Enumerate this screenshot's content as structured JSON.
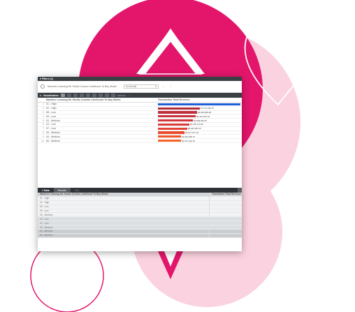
{
  "filters": {
    "title": "Filters (1)",
    "field_label": "Machine Learning ML Studio Custom Likelihood To Buy Model",
    "operator": "is not null",
    "add_symbol": "+",
    "remove_symbol": "×"
  },
  "visualization": {
    "title": "Visualization",
    "toolbar_text": "Options",
    "col_category": "Machine Learning ML Studio Custom Likelihood To Buy Model",
    "col_measure": "Transaction Total Revenue"
  },
  "chart_data": {
    "type": "bar",
    "categories": [
      "01 - High",
      "02 - High",
      "08 - Low",
      "09 - Low",
      "03 - Medium",
      "10 - Low",
      "07 - Low",
      "05 - Medium",
      "04 - Medium",
      "06 - Medium"
    ],
    "values": [
      14000000,
      7079060.57,
      6690899.28,
      6410209.44,
      5898699.87,
      5350113.92,
      5016081.97,
      4517147.22,
      3952868.27,
      3972219.3
    ],
    "labels": [
      "",
      "$7,079,060.57",
      "$6,690,899.28",
      "$6,410,209.44",
      "$5,898,699.87",
      "$5,350,113.92",
      "$5,016,081.97",
      "$4,517,147.22",
      "$3,952,868.27",
      "$3,972,219.30"
    ],
    "indices": [
      "1",
      "2",
      "3",
      "4",
      "5",
      "6",
      "7",
      "8",
      "9",
      "10"
    ],
    "colors": [
      "#1d5fd6",
      "#b22e3a",
      "#c1313b",
      "#c8323c",
      "#d2363c",
      "#da3c3a",
      "#e24336",
      "#ea4c31",
      "#f0542a",
      "#f56024"
    ],
    "ylim": [
      0,
      14000000
    ]
  },
  "data_panel": {
    "title": "Data",
    "tab_results": "Results",
    "tab_sql": "SQL",
    "col_category": "Machine Learning ML Studio Custom Likelihood To Buy Model",
    "col_measure": "Transaction Total Revenue",
    "rows": [
      "01 - High",
      "02 - High",
      "08 - Low",
      "09 - Low",
      "03 - Medium",
      "10 - Low",
      "07 - Low",
      "05 - Medium",
      "04 - Medium",
      "06 - Medium"
    ]
  }
}
